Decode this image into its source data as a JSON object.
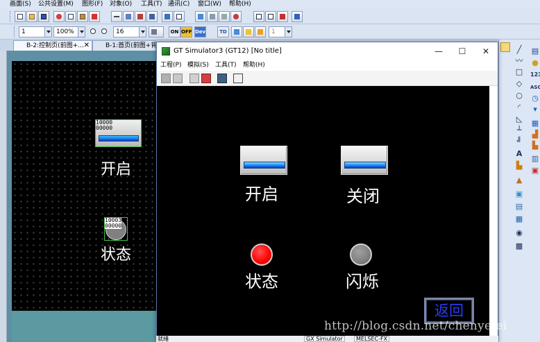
{
  "editor": {
    "menu": [
      "画面(S)",
      "公共设置(M)",
      "图形(F)",
      "对象(O)",
      "工具(T)",
      "通讯(C)",
      "窗口(W)",
      "帮助(H)"
    ],
    "toolbar": {
      "layer_select": "1",
      "zoom_select": "100%",
      "grid_select": "16",
      "on_label": "ON",
      "off_label": "OFF",
      "dev_label": "Dev",
      "td_label": "TD",
      "num_select": "1"
    },
    "tabs": [
      {
        "label": "B-2:控制页(前图+...",
        "close": "✕"
      },
      {
        "label": "B-1:首页(前图+背..."
      }
    ],
    "canvas": {
      "switch_device": "10000\n00000",
      "switch_label": "开启",
      "lamp_device": "10003\n00000",
      "lamp_label": "状态"
    }
  },
  "simulator": {
    "title": "GT Simulator3 (GT12)  [No title]",
    "window_buttons": {
      "minimize": "—",
      "maximize": "☐",
      "close": "✕"
    },
    "menu": [
      "工程(P)",
      "模拟(S)",
      "工具(T)",
      "帮助(H)"
    ],
    "screen": {
      "switches": [
        {
          "label": "开启"
        },
        {
          "label": "关闭"
        }
      ],
      "lamps": [
        {
          "label": "状态",
          "state": "on",
          "color": "#ff0000"
        },
        {
          "label": "闪烁",
          "state": "off",
          "color": "#808080"
        }
      ],
      "back_button": "返回"
    },
    "status": {
      "left": "就绪",
      "cells": [
        "GX Simulator",
        "MELSEC-FX"
      ]
    }
  },
  "watermark": "http://blog.csdn.net/chenyefei"
}
